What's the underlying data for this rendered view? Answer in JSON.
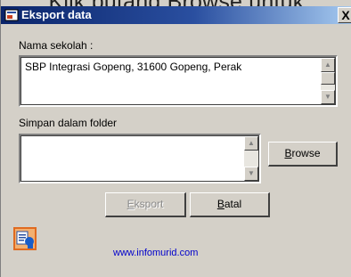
{
  "caption": "Klik butang Browse untuk",
  "window": {
    "title": "Eksport data",
    "close_label": "X"
  },
  "form": {
    "school_label": "Nama sekolah :",
    "school_value": "SBP Integrasi Gopeng, 31600 Gopeng, Perak",
    "folder_label": "Simpan dalam folder",
    "folder_value": ""
  },
  "buttons": {
    "browse_first": "B",
    "browse_rest": "rowse",
    "export_first": "E",
    "export_rest": "ksport",
    "cancel_first": "B",
    "cancel_rest": "atal"
  },
  "footer": {
    "link": "www.infomurid.com"
  },
  "icons": {
    "title": "app-window-icon",
    "app": "app-data-icon"
  },
  "colors": {
    "titlebar_start": "#0a246a",
    "titlebar_end": "#a6caf0",
    "dialog_bg": "#d4d0c8",
    "link": "#0000cc"
  }
}
